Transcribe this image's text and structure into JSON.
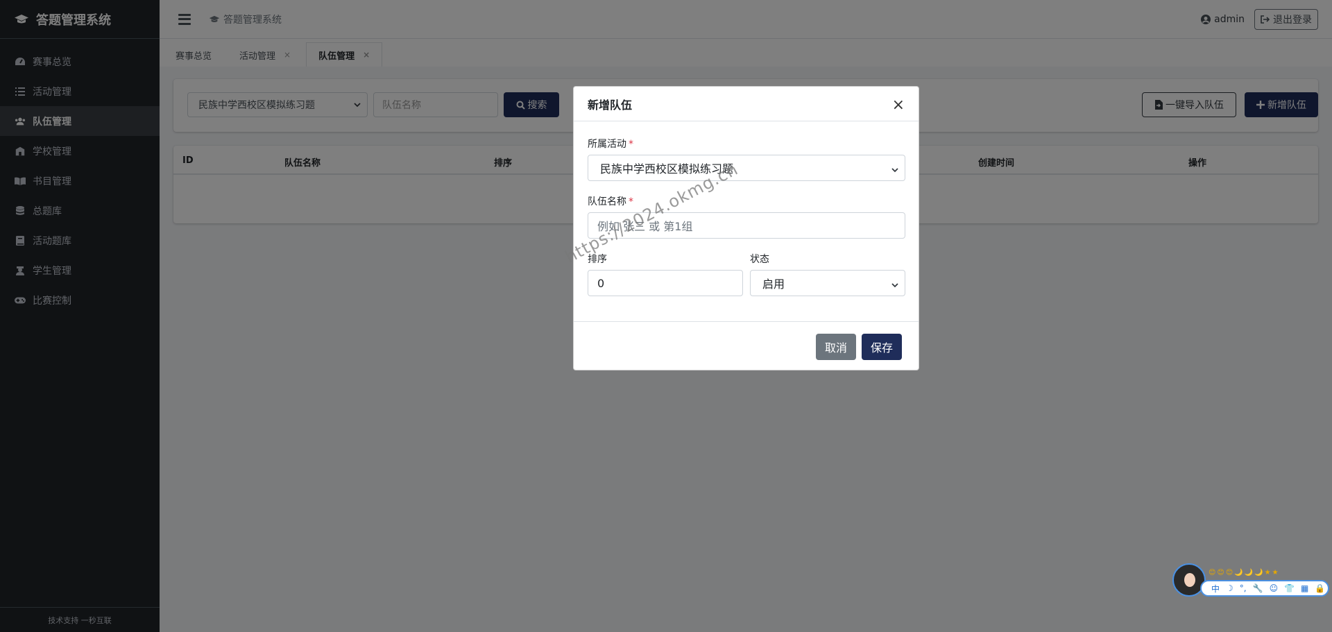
{
  "app": {
    "brand": "答题管理系统",
    "header_title": "答题管理系统",
    "user": "admin",
    "logout_label": "退出登录",
    "footer": "技术支持 一秒互联"
  },
  "sidebar": {
    "items": [
      {
        "label": "赛事总览",
        "icon": "dashboard-icon",
        "active": false
      },
      {
        "label": "活动管理",
        "icon": "list-icon",
        "active": false
      },
      {
        "label": "队伍管理",
        "icon": "users-icon",
        "active": true
      },
      {
        "label": "学校管理",
        "icon": "school-icon",
        "active": false
      },
      {
        "label": "书目管理",
        "icon": "book-icon",
        "active": false
      },
      {
        "label": "总题库",
        "icon": "database-icon",
        "active": false
      },
      {
        "label": "活动题库",
        "icon": "book-closed-icon",
        "active": false
      },
      {
        "label": "学生管理",
        "icon": "student-icon",
        "active": false
      },
      {
        "label": "比赛控制",
        "icon": "gamepad-icon",
        "active": false
      }
    ]
  },
  "tabs": [
    {
      "label": "赛事总览",
      "closable": false,
      "active": false
    },
    {
      "label": "活动管理",
      "closable": true,
      "active": false
    },
    {
      "label": "队伍管理",
      "closable": true,
      "active": true
    }
  ],
  "filter": {
    "activity_selected": "民族中学西校区模拟练习题",
    "name_placeholder": "队伍名称",
    "search_label": "搜索",
    "import_label": "一键导入队伍",
    "add_label": "新增队伍"
  },
  "table": {
    "headers": [
      "ID",
      "队伍名称",
      "排序",
      "",
      "创建时间",
      "操作"
    ]
  },
  "modal": {
    "title": "新增队伍",
    "close": "×",
    "activity_label": "所属活动",
    "activity_value": "民族中学西校区模拟练习题",
    "name_label": "队伍名称",
    "name_placeholder": "例如 张三 或 第1组",
    "sort_label": "排序",
    "sort_value": "0",
    "status_label": "状态",
    "status_value": "启用",
    "cancel_label": "取消",
    "save_label": "保存",
    "required_mark": "*"
  },
  "watermark": "https://2024.okmg.cn",
  "ime": {
    "emojis": "😊😊😊🌙🌙🌙★★",
    "items": [
      "中",
      "☽",
      "°,",
      "🔧",
      "☺",
      "👕",
      "▦",
      "🔒"
    ]
  }
}
